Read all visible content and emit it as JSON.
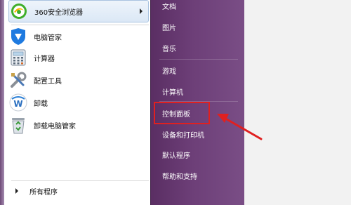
{
  "left_panel": {
    "programs": [
      {
        "label": "360安全浏览器",
        "icon": "360-browser-icon",
        "has_submenu": true
      },
      {
        "label": "电脑管家",
        "icon": "pc-manager-icon",
        "has_submenu": false
      },
      {
        "label": "计算器",
        "icon": "calculator-icon",
        "has_submenu": false
      },
      {
        "label": "配置工具",
        "icon": "config-tools-icon",
        "has_submenu": false
      },
      {
        "label": "卸载",
        "icon": "uninstall-icon",
        "has_submenu": false
      },
      {
        "label": "卸载电脑管家",
        "icon": "recycle-bin-icon",
        "has_submenu": false
      }
    ],
    "all_programs": "所有程序"
  },
  "right_panel": {
    "items": [
      "文档",
      "图片",
      "音乐",
      "游戏",
      "计算机",
      "控制面板",
      "设备和打印机",
      "默认程序",
      "帮助和支持"
    ],
    "highlighted": "控制面板"
  },
  "colors": {
    "right_panel": "#6d3f78",
    "highlight": "#e02020",
    "annotation_arrow": "#e02020"
  }
}
